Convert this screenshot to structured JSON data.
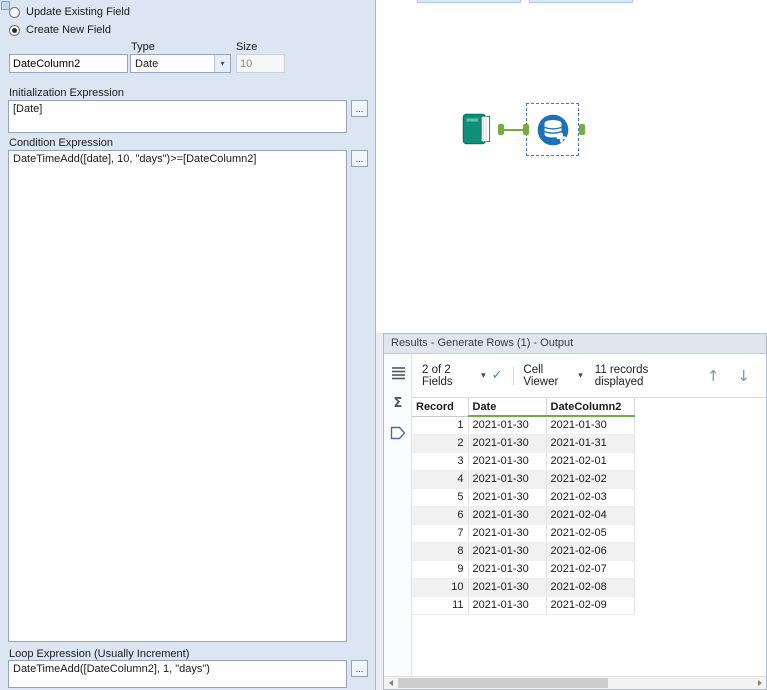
{
  "config": {
    "radio_update_label": "Update Existing Field",
    "radio_create_label": "Create New Field",
    "field_name": "DateColumn2",
    "type_label": "Type",
    "type_value": "Date",
    "size_label": "Size",
    "size_value": "10",
    "init_label": "Initialization Expression",
    "init_value": "[Date]",
    "condition_label": "Condition Expression",
    "condition_value": "DateTimeAdd([date], 10, \"days\")>=[DateColumn2]",
    "loop_label": "Loop Expression (Usually Increment)",
    "loop_value": "DateTimeAdd([DateColumn2], 1, \"days\")",
    "browse_label": "..."
  },
  "results": {
    "title": "Results - Generate Rows (1) - Output",
    "toolbar": {
      "fields_label": "2 of 2 Fields",
      "cell_viewer_label": "Cell Viewer",
      "records_label": "11 records displayed"
    },
    "table": {
      "columns": [
        "Record",
        "Date",
        "DateColumn2"
      ],
      "rows": [
        [
          "1",
          "2021-01-30",
          "2021-01-30"
        ],
        [
          "2",
          "2021-01-30",
          "2021-01-31"
        ],
        [
          "3",
          "2021-01-30",
          "2021-02-01"
        ],
        [
          "4",
          "2021-01-30",
          "2021-02-02"
        ],
        [
          "5",
          "2021-01-30",
          "2021-02-03"
        ],
        [
          "6",
          "2021-01-30",
          "2021-02-04"
        ],
        [
          "7",
          "2021-01-30",
          "2021-02-05"
        ],
        [
          "8",
          "2021-01-30",
          "2021-02-06"
        ],
        [
          "9",
          "2021-01-30",
          "2021-02-07"
        ],
        [
          "10",
          "2021-01-30",
          "2021-02-08"
        ],
        [
          "11",
          "2021-01-30",
          "2021-02-09"
        ]
      ]
    }
  },
  "icons": {
    "caret_down": "▾",
    "check": "✓",
    "arrow_up": "↑",
    "arrow_down": "↓",
    "sigma": "Σ"
  },
  "colors": {
    "config_panel_bg": "#dce6f2",
    "results_header_bg": "#dfe5ef",
    "selection_blue": "#3f7fbf",
    "connection_green": "#76ad3a",
    "generate_rows_blue": "#1d71b8",
    "input_tool_teal": "#0f8f7a",
    "header_underline_green": "#6fae3e",
    "check_teal": "#13a18d"
  }
}
